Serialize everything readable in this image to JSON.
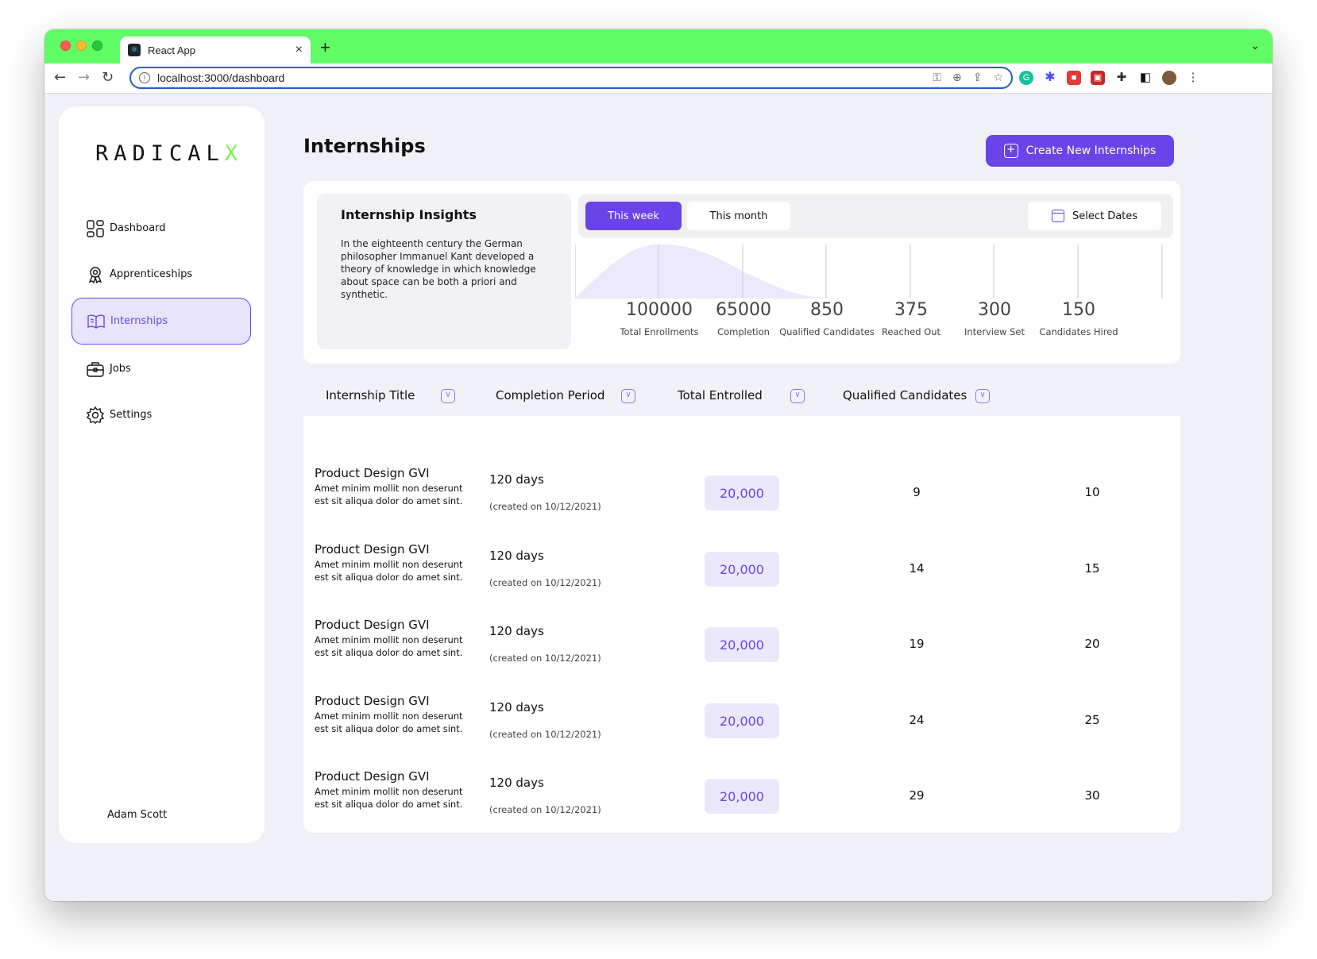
{
  "browser": {
    "tab_title": "React App",
    "tab_close": "×",
    "new_tab": "+",
    "url": "localhost:3000/dashboard"
  },
  "sidebar": {
    "logo_main": "RADICAL",
    "logo_accent": "X",
    "items": [
      {
        "label": "Dashboard",
        "icon": "dashboard-icon"
      },
      {
        "label": "Apprenticeships",
        "icon": "award-icon"
      },
      {
        "label": "Internships",
        "icon": "book-icon",
        "active": true
      },
      {
        "label": "Jobs",
        "icon": "briefcase-icon"
      },
      {
        "label": "Settings",
        "icon": "gear-icon"
      }
    ],
    "user_name": "Adam Scott"
  },
  "header": {
    "title": "Internships",
    "create_button": "Create New Internships"
  },
  "insights": {
    "title": "Internship Insights",
    "description": "In the eighteenth century the German philosopher Immanuel Kant developed a theory of knowledge in which knowledge about space can be both a priori and synthetic.",
    "range": {
      "this_week": "This week",
      "this_month": "This month",
      "select_dates": "Select Dates"
    },
    "stats": [
      {
        "value": "100000",
        "label": "Total Enrollments"
      },
      {
        "value": "65000",
        "label": "Completion"
      },
      {
        "value": "850",
        "label": "Qualified Candidates"
      },
      {
        "value": "375",
        "label": "Reached Out"
      },
      {
        "value": "300",
        "label": "Interview Set"
      },
      {
        "value": "150",
        "label": "Candidates Hired"
      }
    ]
  },
  "table": {
    "headers": [
      "Internship Title",
      "Completion Period",
      "Total Entrolled",
      "Qualified Candidates"
    ],
    "rows": [
      {
        "title": "Product Design GVI",
        "desc": "Amet minim mollit non deserunt est sit aliqua dolor do amet sint.",
        "days": "120 days",
        "created": "(created on 10/12/2021)",
        "enrolled": "20,000",
        "qualified": "9",
        "other": "10"
      },
      {
        "title": "Product Design GVI",
        "desc": "Amet minim mollit non deserunt est sit aliqua dolor do amet sint.",
        "days": "120 days",
        "created": "(created on 10/12/2021)",
        "enrolled": "20,000",
        "qualified": "14",
        "other": "15"
      },
      {
        "title": "Product Design GVI",
        "desc": "Amet minim mollit non deserunt est sit aliqua dolor do amet sint.",
        "days": "120 days",
        "created": "(created on 10/12/2021)",
        "enrolled": "20,000",
        "qualified": "19",
        "other": "20"
      },
      {
        "title": "Product Design GVI",
        "desc": "Amet minim mollit non deserunt est sit aliqua dolor do amet sint.",
        "days": "120 days",
        "created": "(created on 10/12/2021)",
        "enrolled": "20,000",
        "qualified": "24",
        "other": "25"
      },
      {
        "title": "Product Design GVI",
        "desc": "Amet minim mollit non deserunt est sit aliqua dolor do amet sint.",
        "days": "120 days",
        "created": "(created on 10/12/2021)",
        "enrolled": "20,000",
        "qualified": "29",
        "other": "30"
      }
    ]
  },
  "colors": {
    "browser_frame": "#61fb66",
    "accent": "#6a44e8",
    "accent_light": "#ebe8fc",
    "logo_accent": "#7cf34f",
    "background": "#eff1f6"
  }
}
